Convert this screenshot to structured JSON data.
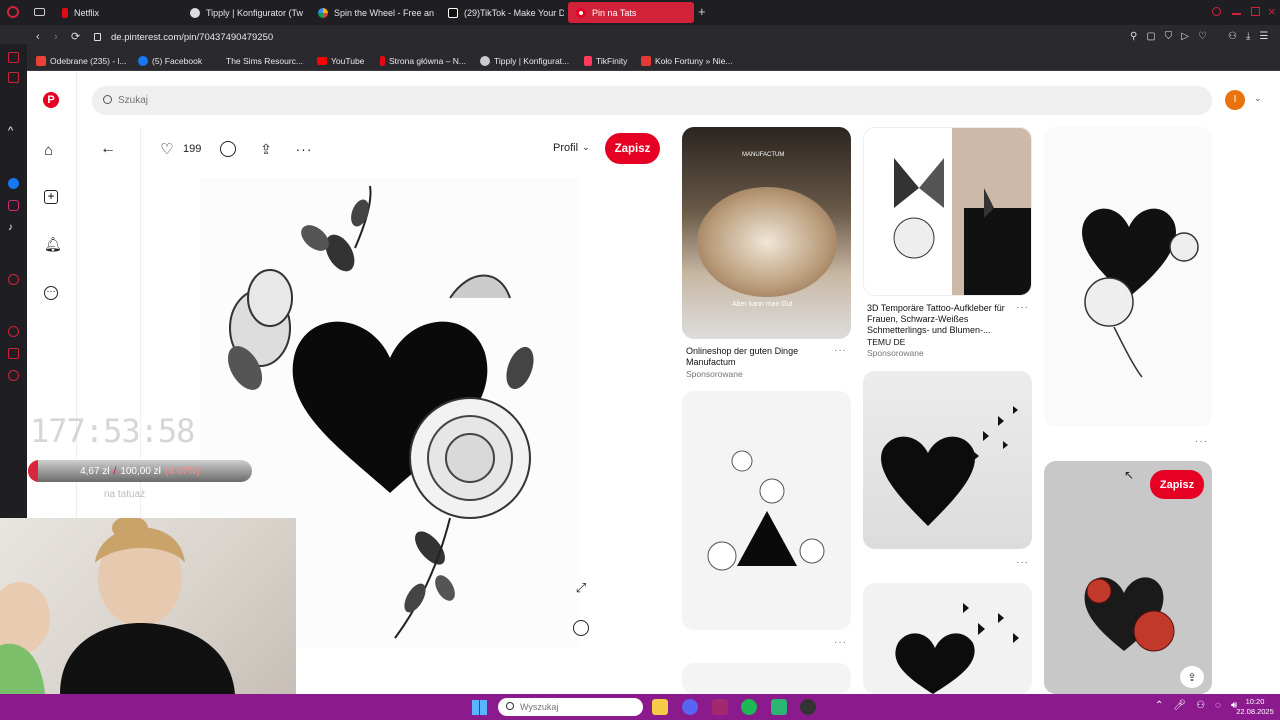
{
  "tabs": [
    {
      "label": "Netflix",
      "color": "#e50914"
    },
    {
      "label": "Tipply | Konfigurator (Tw",
      "color": "#ffffff"
    },
    {
      "label": "Spin the Wheel - Free an",
      "color": "#f4b400"
    },
    {
      "label": "(29)TikTok - Make Your D",
      "color": "#ffffff"
    },
    {
      "label": "Pin na Tats",
      "color": "#e60023",
      "active": true
    }
  ],
  "address": {
    "url": "de.pinterest.com/pin/70437490479250"
  },
  "bookmarks": [
    {
      "label": "Odebrane (235) - l...",
      "color": "#ea4335"
    },
    {
      "label": "(5) Facebook",
      "color": "#1877f2"
    },
    {
      "label": "The Sims Resourc...",
      "color": "#ffffff"
    },
    {
      "label": "YouTube",
      "color": "#ff0000"
    },
    {
      "label": "Strona główna – N...",
      "color": "#e50914"
    },
    {
      "label": "Tipply | Konfigurat...",
      "color": "#ffffff"
    },
    {
      "label": "TikFinity",
      "color": "#ff3b5c"
    },
    {
      "label": "Koło Fortuny » Nie...",
      "color": "#e53935"
    }
  ],
  "search": {
    "placeholder": "Szukaj"
  },
  "user": {
    "initial": "I",
    "color": "#e8730c"
  },
  "pin": {
    "likes": "199",
    "profile_label": "Profil",
    "save_label": "Zapisz"
  },
  "feed": {
    "card1": {
      "title": "Onlineshop der guten Dinge Manufactum",
      "sub": "Sponsorowane",
      "overlay_text": "MANUFACTUM",
      "overlay_caption": "Aber kann man Gut"
    },
    "card2": {
      "title": "3D Temporäre Tattoo-Aufkleber für Frauen, Schwarz-Weißes Schmetterlings- und Blumen-...",
      "advertiser": "TEMU DE",
      "sub": "Sponsorowane"
    },
    "hover_save_label": "Zapisz"
  },
  "overlay": {
    "timer": "177:53:58",
    "progress_current": "4,67 zł",
    "progress_sep": "/",
    "progress_goal": "100,00 zł",
    "progress_pct": "(4.67%)",
    "progress_fraction": 0.0467,
    "caption": "na tatuaż"
  },
  "taskbar": {
    "search_placeholder": "Wyszukaj",
    "time": "10:20",
    "date": "22.08.2025"
  },
  "colors": {
    "brand": "#e60023",
    "taskbar": "#8b1a8d"
  }
}
